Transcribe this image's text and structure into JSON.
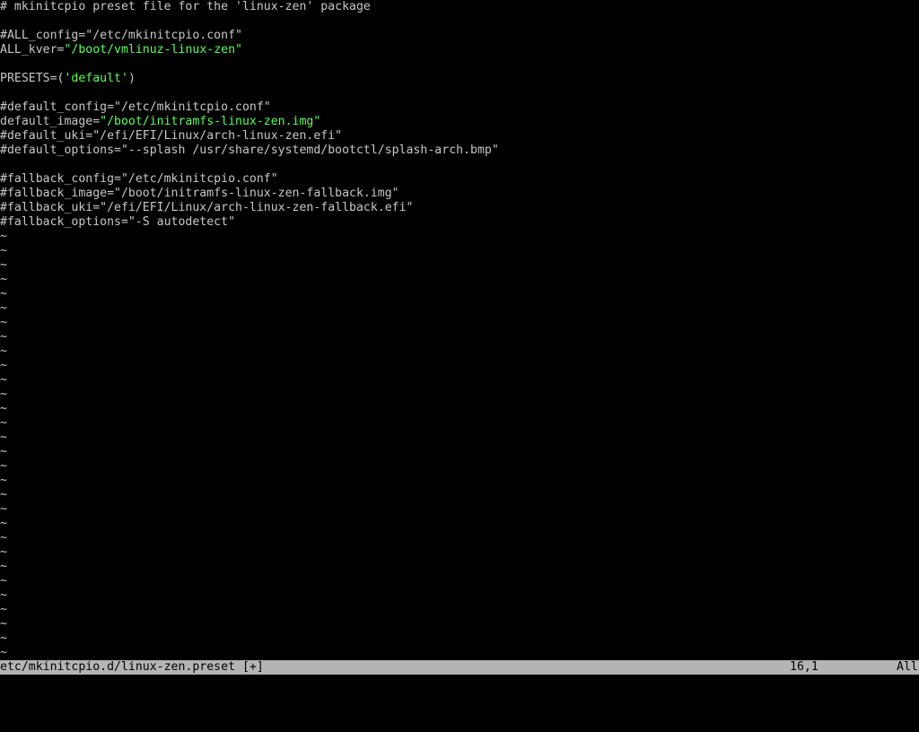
{
  "colors": {
    "background": "#000000",
    "text": "#c8c8c8",
    "string": "#5dfc5d",
    "statusbar_bg": "#b4b4b4",
    "statusbar_fg": "#000000"
  },
  "editor": {
    "lines": [
      [
        {
          "t": "# mkinitcpio preset file for the 'linux-zen' package",
          "c": "comment"
        }
      ],
      [],
      [
        {
          "t": "#ALL_config=\"/etc/mkinitcpio.conf\"",
          "c": "comment"
        }
      ],
      [
        {
          "t": "ALL_kver=",
          "c": "plain"
        },
        {
          "t": "\"/boot/vmlinuz-linux-zen\"",
          "c": "string"
        }
      ],
      [],
      [
        {
          "t": "PRESETS=(",
          "c": "plain"
        },
        {
          "t": "'default'",
          "c": "string"
        },
        {
          "t": ")",
          "c": "plain"
        }
      ],
      [],
      [
        {
          "t": "#default_config=\"/etc/mkinitcpio.conf\"",
          "c": "comment"
        }
      ],
      [
        {
          "t": "default_image=",
          "c": "plain"
        },
        {
          "t": "\"/boot/initramfs-linux-zen.img\"",
          "c": "string"
        }
      ],
      [
        {
          "t": "#default_uki=\"/efi/EFI/Linux/arch-linux-zen.efi\"",
          "c": "comment"
        }
      ],
      [
        {
          "t": "#default_options=\"--splash /usr/share/systemd/bootctl/splash-arch.bmp\"",
          "c": "comment"
        }
      ],
      [],
      [
        {
          "t": "#fallback_config=\"/etc/mkinitcpio.conf\"",
          "c": "comment"
        }
      ],
      [
        {
          "t": "#fallback_image=\"/boot/initramfs-linux-zen-fallback.img\"",
          "c": "comment"
        }
      ],
      [
        {
          "t": "#fallback_uki=\"/efi/EFI/Linux/arch-linux-zen-fallback.efi\"",
          "c": "comment"
        }
      ],
      [
        {
          "t": "#fallback_options=\"-S autodetect\"",
          "c": "comment"
        }
      ]
    ],
    "tilde_char": "~",
    "tilde_count": 30
  },
  "statusbar": {
    "filename": "etc/mkinitcpio.d/linux-zen.preset [+]",
    "cursor_position": "16,1",
    "scroll_position": "All"
  }
}
